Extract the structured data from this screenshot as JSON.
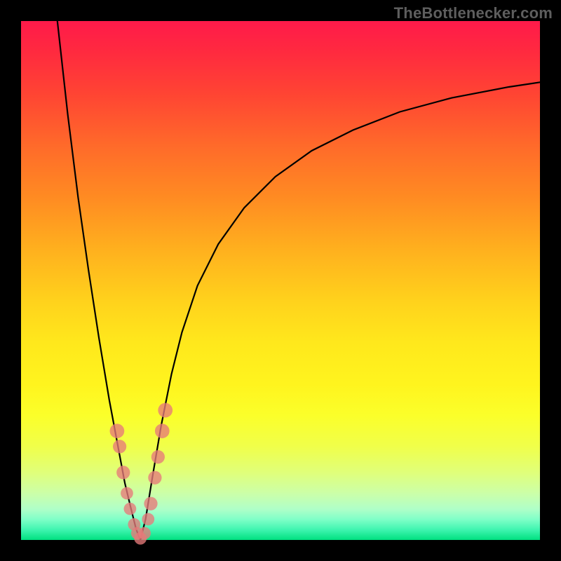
{
  "watermark": "TheBottlenecker.com",
  "colors": {
    "frame": "#000000",
    "curve": "#000000",
    "marker": "#e77a7a",
    "gradient_top": "#ff1a4a",
    "gradient_bottom": "#00e080"
  },
  "chart_data": {
    "type": "line",
    "title": "",
    "xlabel": "",
    "ylabel": "",
    "xlim": [
      0,
      100
    ],
    "ylim": [
      0,
      100
    ],
    "grid": false,
    "legend": false,
    "series": [
      {
        "name": "left-branch",
        "x": [
          7,
          9,
          11,
          13,
          15,
          17,
          18.5,
          20,
          21.2,
          22.2,
          23
        ],
        "values": [
          100,
          82,
          66,
          52,
          39,
          27,
          19,
          11,
          6,
          2,
          0
        ]
      },
      {
        "name": "right-branch",
        "x": [
          23,
          24,
          25.3,
          27,
          29,
          31,
          34,
          38,
          43,
          49,
          56,
          64,
          73,
          83,
          94,
          100
        ],
        "values": [
          0,
          4,
          12,
          22,
          32,
          40,
          49,
          57,
          64,
          70,
          75,
          79,
          82.5,
          85.2,
          87.3,
          88.2
        ]
      }
    ],
    "markers": {
      "name": "data-points",
      "points": [
        {
          "x": 18.5,
          "y": 21,
          "r": 1.4
        },
        {
          "x": 19.0,
          "y": 18,
          "r": 1.3
        },
        {
          "x": 19.7,
          "y": 13,
          "r": 1.3
        },
        {
          "x": 20.4,
          "y": 9,
          "r": 1.2
        },
        {
          "x": 21.0,
          "y": 6,
          "r": 1.2
        },
        {
          "x": 21.8,
          "y": 3,
          "r": 1.2
        },
        {
          "x": 22.4,
          "y": 1.3,
          "r": 1.2
        },
        {
          "x": 23.0,
          "y": 0.3,
          "r": 1.2
        },
        {
          "x": 23.8,
          "y": 1.3,
          "r": 1.2
        },
        {
          "x": 24.5,
          "y": 4,
          "r": 1.2
        },
        {
          "x": 25.0,
          "y": 7,
          "r": 1.3
        },
        {
          "x": 25.8,
          "y": 12,
          "r": 1.3
        },
        {
          "x": 26.4,
          "y": 16,
          "r": 1.3
        },
        {
          "x": 27.2,
          "y": 21,
          "r": 1.4
        },
        {
          "x": 27.8,
          "y": 25,
          "r": 1.4
        }
      ]
    }
  }
}
